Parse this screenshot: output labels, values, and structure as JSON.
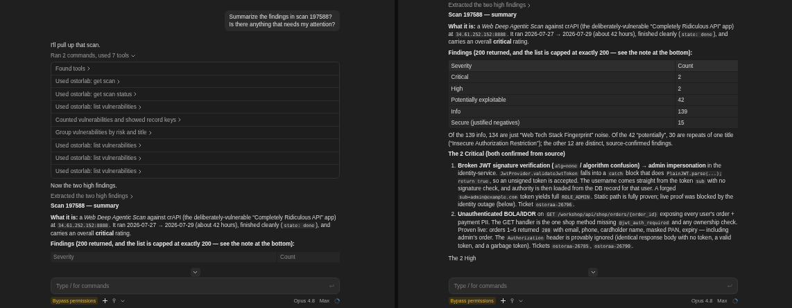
{
  "panes": [
    {
      "blocks": [
        {
          "kind": "user_bubble",
          "lines": [
            "Summarize the findings in scan 197588?",
            "Is there anything that needs my attention?"
          ]
        },
        {
          "kind": "paragraph",
          "spans": [
            {
              "kind": "plain",
              "text": "I'll pull up that scan."
            }
          ]
        },
        {
          "kind": "tool_summary",
          "text": "Ran 2 commands, used 7 tools",
          "expanded": true
        },
        {
          "kind": "tool_list",
          "items": [
            "Found tools",
            "Used ostorlab: get scan",
            "Used ostorlab: get scan status",
            "Used ostorlab: list vulnerabilities",
            "Counted vulnerabilities and showed record keys",
            "Group vulnerabilities by risk and title",
            "Used ostorlab: list vulnerabilities",
            "Used ostorlab: list vulnerabilities",
            "Used ostorlab: list vulnerabilities"
          ]
        },
        {
          "kind": "paragraph",
          "spans": [
            {
              "kind": "plain",
              "text": "Now the two high findings."
            }
          ]
        },
        {
          "kind": "tool_summary",
          "text": "Extracted the two high findings",
          "expanded": false
        },
        {
          "kind": "heading",
          "text": "Scan 197588 — summary"
        },
        {
          "kind": "paragraph",
          "spans": [
            {
              "kind": "bold",
              "text": "What it is:"
            },
            {
              "kind": "plain",
              "text": " a "
            },
            {
              "kind": "italic",
              "text": "Web Deep Agentic Scan"
            },
            {
              "kind": "plain",
              "text": " against crAPI (the deliberately-vulnerable “Completely Ridiculous API” app) at "
            },
            {
              "kind": "code",
              "text": "34.61.252.152:8888"
            },
            {
              "kind": "plain",
              "text": ". It ran 2026-07-27 → 2026-07-29 (about 42 hours), finished cleanly ("
            },
            {
              "kind": "code",
              "text": "state: done"
            },
            {
              "kind": "plain",
              "text": "), and carries an overall "
            },
            {
              "kind": "bold",
              "text": "critical"
            },
            {
              "kind": "plain",
              "text": " rating."
            }
          ]
        },
        {
          "kind": "heading",
          "text": "Findings (200 returned, and the list is capped at exactly 200 — see the note at the bottom):"
        },
        {
          "kind": "table",
          "columns": [
            "Severity",
            "Count"
          ]
        }
      ],
      "composer": {
        "placeholder": "Type / for commands"
      },
      "footer": {
        "mode": "Bypass permissions",
        "model": "Opus 4.8",
        "effort": "Max"
      }
    },
    {
      "blocks": [
        {
          "kind": "tool_summary",
          "text": "Extracted the two high findings",
          "expanded": false
        },
        {
          "kind": "heading",
          "text": "Scan 197588 — summary"
        },
        {
          "kind": "paragraph",
          "spans": [
            {
              "kind": "bold",
              "text": "What it is:"
            },
            {
              "kind": "plain",
              "text": " a "
            },
            {
              "kind": "italic",
              "text": "Web Deep Agentic Scan"
            },
            {
              "kind": "plain",
              "text": " against crAPI (the deliberately-vulnerable “Completely Ridiculous API” app) at "
            },
            {
              "kind": "code",
              "text": "34.61.252.152:8888"
            },
            {
              "kind": "plain",
              "text": ". It ran 2026-07-27 → 2026-07-29 (about 42 hours), finished cleanly ("
            },
            {
              "kind": "code",
              "text": "state: done"
            },
            {
              "kind": "plain",
              "text": "), and carries an overall "
            },
            {
              "kind": "bold",
              "text": "critical"
            },
            {
              "kind": "plain",
              "text": " rating."
            }
          ]
        },
        {
          "kind": "heading",
          "text": "Findings (200 returned, and the list is capped at exactly 200 — see the note at the bottom):"
        },
        {
          "kind": "table",
          "columns": [
            "Severity",
            "Count"
          ],
          "rows": [
            [
              "Critical",
              "2"
            ],
            [
              "High",
              "2"
            ],
            [
              "Potentially exploitable",
              "42"
            ],
            [
              "Info",
              "139"
            ],
            [
              "Secure (justified negatives)",
              "15"
            ]
          ]
        },
        {
          "kind": "paragraph",
          "spans": [
            {
              "kind": "plain",
              "text": "Of the 139 info, 134 are just “Web Tech Stack Fingerprint” noise. Of the 42 “potentially”, 30 are repeats of one title (“Insecure Authorization Restriction”); the other 12 are distinct, source-confirmed findings."
            }
          ]
        },
        {
          "kind": "heading",
          "text": "The 2 Critical (both confirmed from source)"
        },
        {
          "kind": "ordered_list",
          "items": [
            {
              "number": "1.",
              "spans": [
                {
                  "kind": "bold",
                  "text": "Broken JWT signature verification ("
                },
                {
                  "kind": "code",
                  "text": "alg=none"
                },
                {
                  "kind": "bold",
                  "text": " / algorithm confusion) → admin impersonation"
                },
                {
                  "kind": "plain",
                  "text": " in the identity-service. "
                },
                {
                  "kind": "code",
                  "text": "JwtProvider.validateJwtToken"
                },
                {
                  "kind": "plain",
                  "text": " falls into a "
                },
                {
                  "kind": "code",
                  "text": "catch"
                },
                {
                  "kind": "plain",
                  "text": " block that does "
                },
                {
                  "kind": "code",
                  "text": "PlainJWT.parse(...); return true"
                },
                {
                  "kind": "plain",
                  "text": ", so an unsigned token is accepted. The username comes straight from the token "
                },
                {
                  "kind": "code",
                  "text": "sub"
                },
                {
                  "kind": "plain",
                  "text": " with no signature check, and authority is then loaded from the DB record for that user. A forged "
                },
                {
                  "kind": "code",
                  "text": "sub=admin@example.com"
                },
                {
                  "kind": "plain",
                  "text": " token yields full "
                },
                {
                  "kind": "code",
                  "text": "ROLE_ADMIN"
                },
                {
                  "kind": "plain",
                  "text": ". Static path is fully proven; live proof was blocked by the identity outage (below). Ticket "
                },
                {
                  "kind": "code",
                  "text": "ostoraa-26796"
                },
                {
                  "kind": "plain",
                  "text": "."
                }
              ]
            },
            {
              "number": "2.",
              "spans": [
                {
                  "kind": "bold",
                  "text": "Unauthenticated BOLA/IDOR"
                },
                {
                  "kind": "plain",
                  "text": " on "
                },
                {
                  "kind": "code",
                  "text": "GET /workshop/api/shop/orders/{order_id}"
                },
                {
                  "kind": "plain",
                  "text": " exposing every user's order + payment PII. The GET handler is the one shop method missing "
                },
                {
                  "kind": "code",
                  "text": "@jwt_auth_required"
                },
                {
                  "kind": "plain",
                  "text": " and any ownership check. Proven live: orders 1–6 returned "
                },
                {
                  "kind": "code",
                  "text": "200"
                },
                {
                  "kind": "plain",
                  "text": " with email, phone, cardholder name, masked PAN, expiry — including admin's order. The "
                },
                {
                  "kind": "code",
                  "text": "Authorization"
                },
                {
                  "kind": "plain",
                  "text": " header is provably ignored (identical response body with no token, a valid token, and a garbage token). Tickets "
                },
                {
                  "kind": "code",
                  "text": "ostoraa-26785"
                },
                {
                  "kind": "plain",
                  "text": ", "
                },
                {
                  "kind": "code",
                  "text": "ostoraa-26790"
                },
                {
                  "kind": "plain",
                  "text": "."
                }
              ]
            }
          ]
        },
        {
          "kind": "subheading",
          "text": "The 2 High"
        }
      ],
      "composer": {
        "placeholder": "Type / for commands"
      },
      "footer": {
        "mode": "Bypass permissions",
        "model": "Opus 4.8",
        "effort": "Max"
      }
    }
  ]
}
